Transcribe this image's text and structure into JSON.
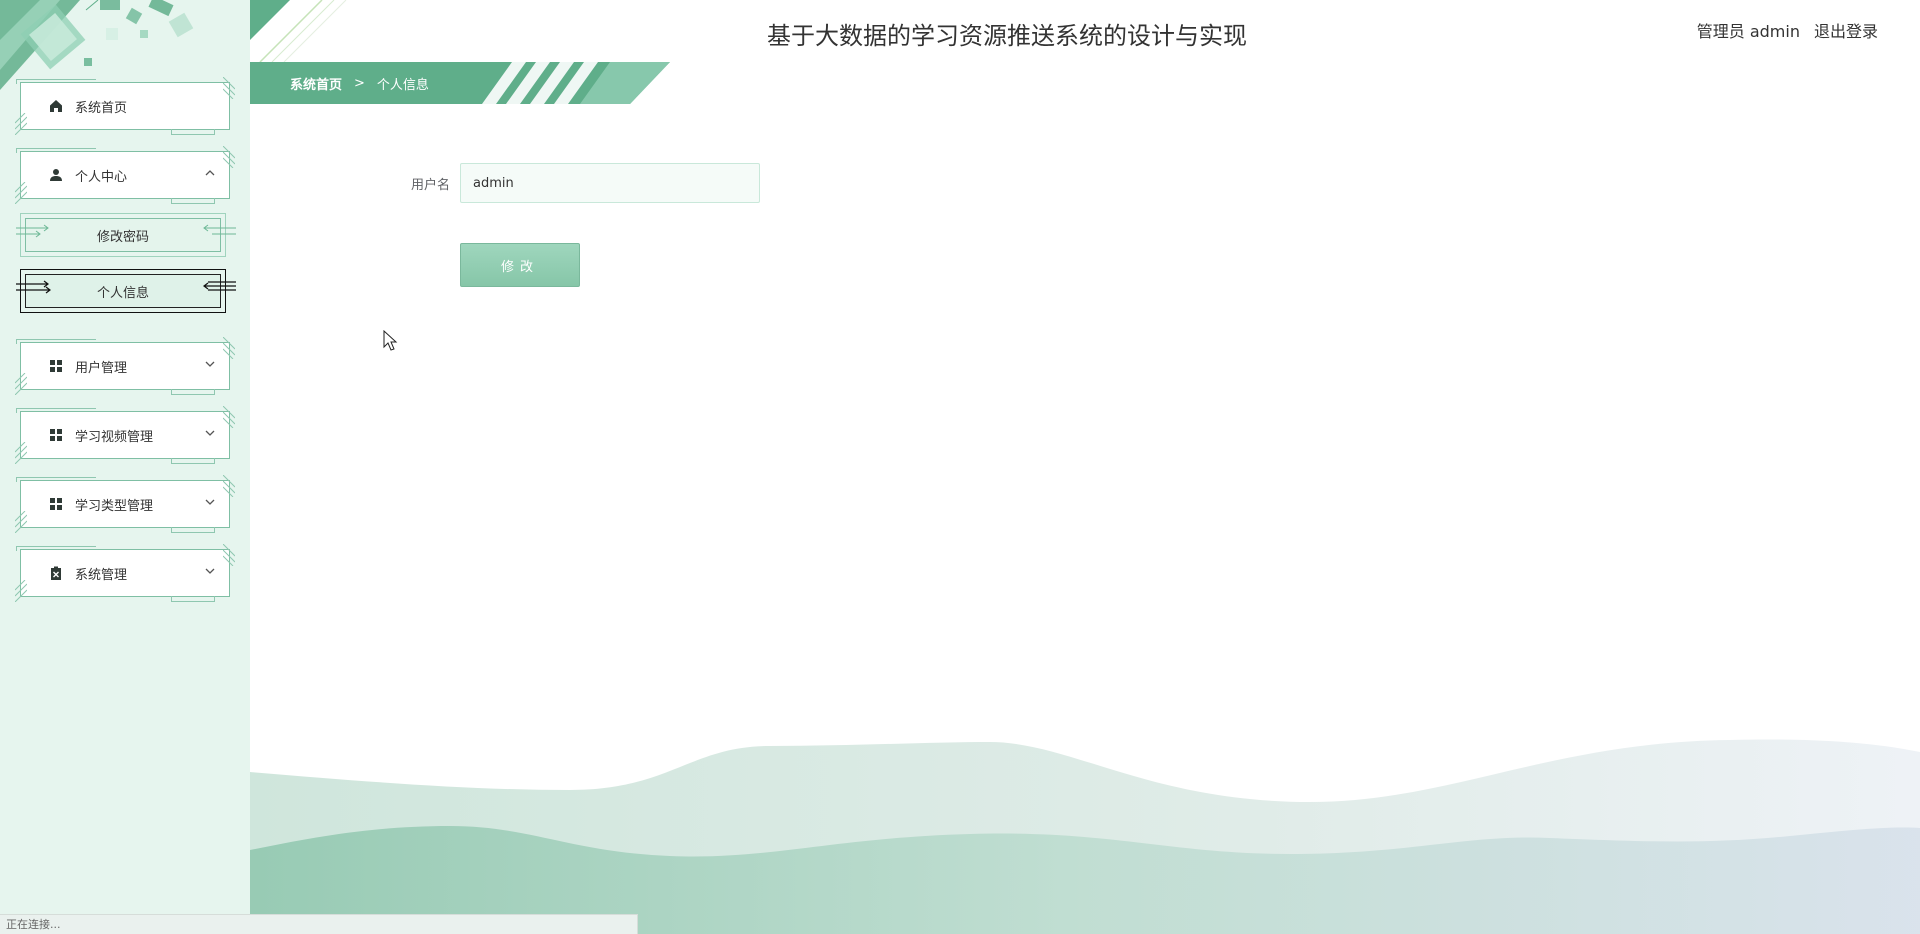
{
  "header": {
    "title": "基于大数据的学习资源推送系统的设计与实现",
    "role_user": "管理员 admin",
    "logout": "退出登录"
  },
  "breadcrumb": {
    "home": "系统首页",
    "separator": ">",
    "current": "个人信息"
  },
  "sidebar": {
    "items": [
      {
        "label": "系统首页",
        "icon": "home-icon",
        "expanded": false
      },
      {
        "label": "个人中心",
        "icon": "user-icon",
        "expanded": true,
        "children": [
          "修改密码",
          "个人信息"
        ]
      },
      {
        "label": "用户管理",
        "icon": "grid-icon",
        "expanded": false
      },
      {
        "label": "学习视频管理",
        "icon": "grid-icon",
        "expanded": false
      },
      {
        "label": "学习类型管理",
        "icon": "grid-icon",
        "expanded": false
      },
      {
        "label": "系统管理",
        "icon": "clipboard-icon",
        "expanded": false
      }
    ],
    "active_child": "个人信息"
  },
  "form": {
    "username_label": "用户名",
    "username_value": "admin",
    "submit_label": "修改"
  },
  "status_bar": {
    "text": "正在连接..."
  },
  "colors": {
    "accent": "#5fae8a",
    "sidebar_bg": "#e6f5ee",
    "menu_border": "#7fbfa4"
  }
}
